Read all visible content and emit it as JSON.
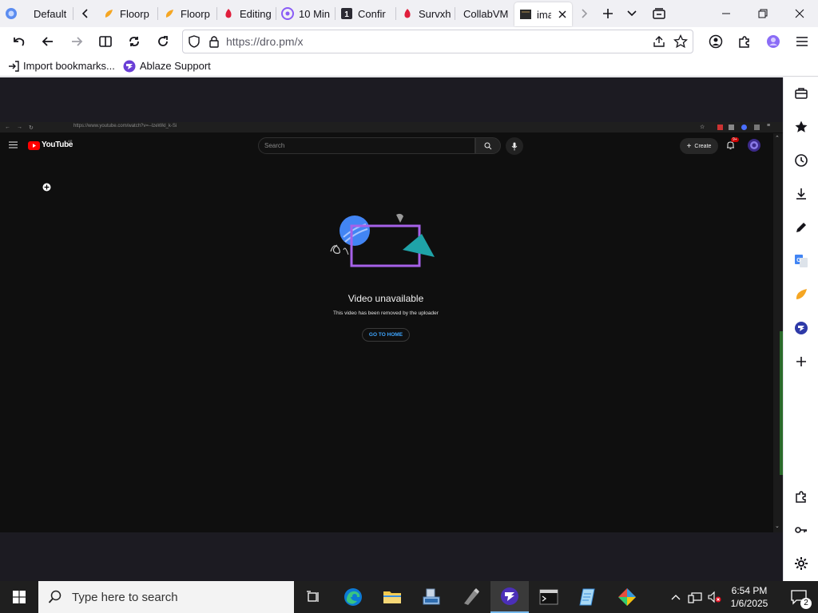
{
  "browser": {
    "tabs": [
      {
        "label": "Default",
        "icon": "firefox-view-icon"
      },
      {
        "label": "Floorp",
        "icon": "floorp-icon"
      },
      {
        "label": "Floorp",
        "icon": "floorp-icon"
      },
      {
        "label": "Editing",
        "icon": "red-flame-icon"
      },
      {
        "label": "10 Min",
        "icon": "at-mail-icon"
      },
      {
        "label": "Confir",
        "icon": "one-icon"
      },
      {
        "label": "Survxh",
        "icon": "red-flame-icon"
      },
      {
        "label": "CollabVM",
        "icon": ""
      },
      {
        "label": "ima",
        "icon": "image-thumb-icon"
      }
    ],
    "url": "https://dro.pm/x",
    "bookmarks": [
      {
        "label": "Import bookmarks...",
        "icon": "import-icon"
      },
      {
        "label": "Ablaze Support",
        "icon": "ablaze-icon"
      }
    ]
  },
  "inner_page": {
    "url": "https://www.youtube.com/watch?v=--lzeWkl_k-Si",
    "logo": "YouTube",
    "logo_region": "AR",
    "search_placeholder": "Search",
    "create_label": "Create",
    "notification_count": "9+",
    "unavailable_title": "Video unavailable",
    "unavailable_subtitle": "This video has been removed by the uploader",
    "go_home_label": "GO TO HOME"
  },
  "taskbar": {
    "search_placeholder": "Type here to search",
    "time": "6:54 PM",
    "date": "1/6/2025",
    "notification_count": "2"
  },
  "colors": {
    "accent_purple": "#7b3fe4",
    "youtube_red": "#ff0000",
    "youtube_link_blue": "#3ea6ff"
  }
}
